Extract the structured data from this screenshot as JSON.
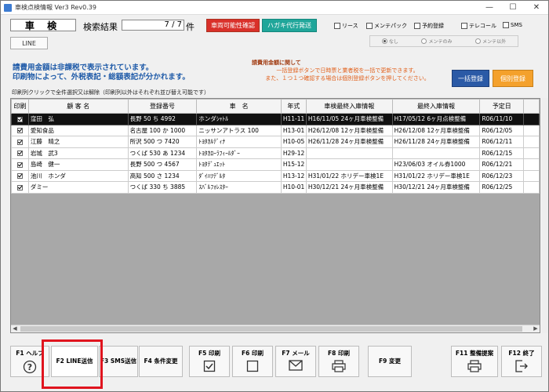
{
  "window": {
    "title": "車検点検情報 Ver3 Rev0.39",
    "controls": [
      "—",
      "☐",
      "✕"
    ]
  },
  "header": {
    "shaken_label": "車 検",
    "search_label": "検索結果",
    "result_count": "7 / 7",
    "ken_label": "件",
    "btn_sharyo": "車両可能性確認",
    "btn_hagaki": "ハガキ代行発送",
    "line_button": "LINE",
    "checkboxes": [
      "リース",
      "メンテパック",
      "予約登録",
      "テレコール",
      "SMS"
    ],
    "radios": [
      "なし",
      "メンテのみ",
      "メンテ以外"
    ]
  },
  "notice": {
    "line1": "請費用金額は非課税で表示されています。",
    "line2": "印刷物によって、外税表記・総額表記が分かれます。",
    "right_head": "請費用金額に関して",
    "right_line1": "一括登録ボタンで日時票と業者税を一括で更新できます。",
    "right_line2": "また、１つ１つ確認する場合は個別登録ボタンを押してください。",
    "bulk_button": "一括登録",
    "individual_button": "個別登録",
    "print_note": "印刷列クリックで全件選択又は解除（印刷列以外はそれぞれ並び替え可能です）"
  },
  "table": {
    "columns": [
      "印刷",
      "顧 客 名",
      "登録番号",
      "車　名",
      "年式",
      "車検最終入庫情報",
      "最終入庫情報",
      "予定日"
    ],
    "rows": [
      {
        "customer": "窪田　弘",
        "reg": "長野 50 ち 4992",
        "car": "ホンダｼｬﾄﾙ",
        "year": "H11-11",
        "shaken_last": "H16/11/05 24ヶ月車検整備",
        "last": "H17/05/12 6ヶ月点検整備",
        "date": "R06/11/10"
      },
      {
        "customer": "愛知食品",
        "reg": "名古屋 100 か 1000",
        "car": "ニッサンアトラス 100",
        "year": "H13-01",
        "shaken_last": "H26/12/08 12ヶ月車検整備",
        "last": "H26/12/08 12ヶ月車検整備",
        "date": "R06/12/05"
      },
      {
        "customer": "江藤　晴之",
        "reg": "所沢 500 つ 7420",
        "car": "ﾄﾖﾀｶﾙﾃﾞｨﾅ",
        "year": "H10-05",
        "shaken_last": "H26/11/28 24ヶ月車検整備",
        "last": "H26/11/28 24ヶ月車検整備",
        "date": "R06/12/11"
      },
      {
        "customer": "岩城　武3",
        "reg": "つくば 530 あ 1234",
        "car": "ﾄﾖﾀｶﾛｰﾗﾌｨｰﾙﾀﾞｰ",
        "year": "H29-12",
        "shaken_last": "",
        "last": "",
        "date": "R06/12/15"
      },
      {
        "customer": "島崎　健一",
        "reg": "長野 500 つ 4567",
        "car": "ﾄﾖﾀﾃﾞｭｴｯﾄ",
        "year": "H15-12",
        "shaken_last": "",
        "last": "H23/06/03 オイル券1000",
        "date": "R06/12/21"
      },
      {
        "customer": "池川　ホンダ",
        "reg": "高知 500 さ 1234",
        "car": "ﾀﾞｲﾊﾂﾃﾞﾙﾀ",
        "year": "H13-12",
        "shaken_last": "H31/01/22 ホリデー車検1E",
        "last": "H31/01/22 ホリデー車検1E",
        "date": "R06/12/23"
      },
      {
        "customer": "ダミー",
        "reg": "つくば 330 ち 3885",
        "car": "ｽﾊﾞﾙﾌｫﾚｽﾀｰ",
        "year": "H10-01",
        "shaken_last": "H30/12/21 24ヶ月車検整備",
        "last": "H30/12/21 24ヶ月車検整備",
        "date": "R06/12/25"
      }
    ]
  },
  "fkeys": {
    "f1": "F1 ヘルプ",
    "f2": "F2 LINE送信",
    "f3": "F3 SMS送信",
    "f4": "F4 条件変更",
    "f5": "F5 印刷",
    "f6": "F6 印刷",
    "f7": "F7 メール",
    "f8": "F8 印刷",
    "f9": "F9 変更",
    "f11": "F11 整備提案",
    "f12": "F12 終了"
  },
  "colors": {
    "red": "#d9302a",
    "teal": "#20a69a",
    "blue": "#2b5aa6",
    "orange": "#f4a12c",
    "highlight": "#e0141e"
  }
}
